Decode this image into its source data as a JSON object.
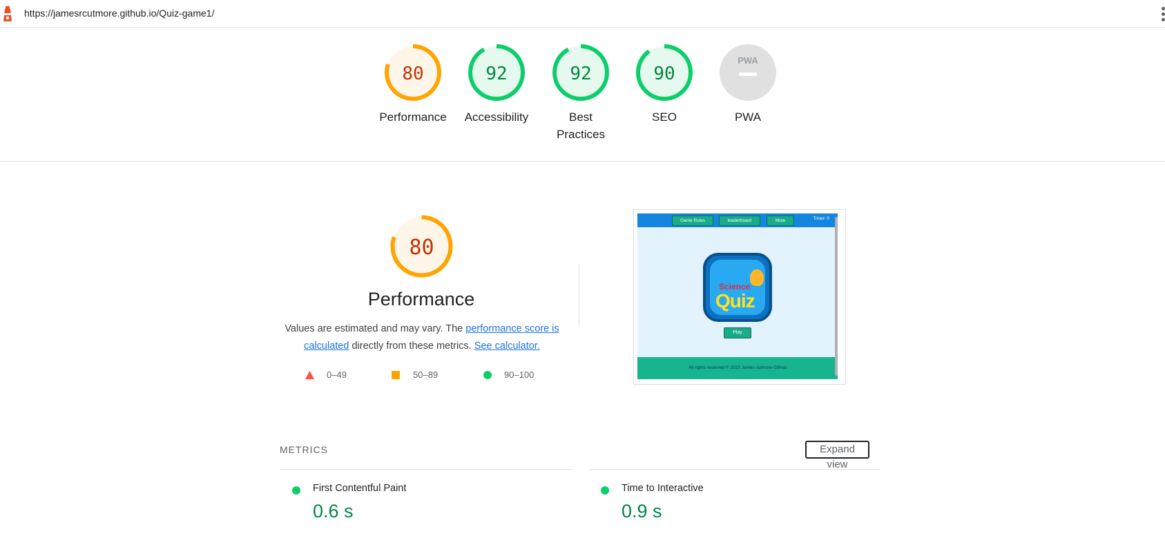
{
  "browser": {
    "url": "https://jamesrcutmore.github.io/Quiz-game1/"
  },
  "gauges": [
    {
      "score": "80",
      "label": "Performance",
      "fraction": 0.8,
      "status": "average"
    },
    {
      "score": "92",
      "label": "Accessibility",
      "fraction": 0.92,
      "status": "pass"
    },
    {
      "score": "92",
      "label": "Best Practices",
      "fraction": 0.92,
      "status": "pass"
    },
    {
      "score": "90",
      "label": "SEO",
      "fraction": 0.9,
      "status": "pass"
    },
    {
      "score": "",
      "label": "PWA",
      "badge": "PWA",
      "status": "na"
    }
  ],
  "colors": {
    "pass": "#0cce6b",
    "pass_text": "#018642",
    "pass_bg": "#e6f9ee",
    "average": "#ffa400",
    "average_text": "#c33300",
    "average_bg": "#fff6ea",
    "fail": "#ff4e42",
    "na_bg": "#e0e0e0",
    "link": "#1a73e8"
  },
  "performance": {
    "score": "80",
    "fraction": 0.8,
    "title": "Performance",
    "desc_prefix": "Values are estimated and may vary. The ",
    "desc_link1": "performance score is calculated",
    "desc_middle": " directly from these metrics. ",
    "desc_link2": "See calculator.",
    "legend": [
      {
        "shape": "triangle",
        "range": "0–49"
      },
      {
        "shape": "square",
        "range": "50–89"
      },
      {
        "shape": "circle",
        "range": "90–100"
      }
    ]
  },
  "thumbnail": {
    "nav_buttons": [
      "Game Rules",
      "leaderboard",
      "Mute"
    ],
    "timer": "Timer: 0",
    "logo_top": "Science",
    "logo_main": "Quiz",
    "play": "Play",
    "footer": "All rights reserved © 2023 James cutmore Github"
  },
  "metrics": {
    "heading": "METRICS",
    "expand_label": "Expand view",
    "items": [
      {
        "name": "First Contentful Paint",
        "value": "0.6 s",
        "status": "pass"
      },
      {
        "name": "Time to Interactive",
        "value": "0.9 s",
        "status": "pass"
      }
    ]
  }
}
